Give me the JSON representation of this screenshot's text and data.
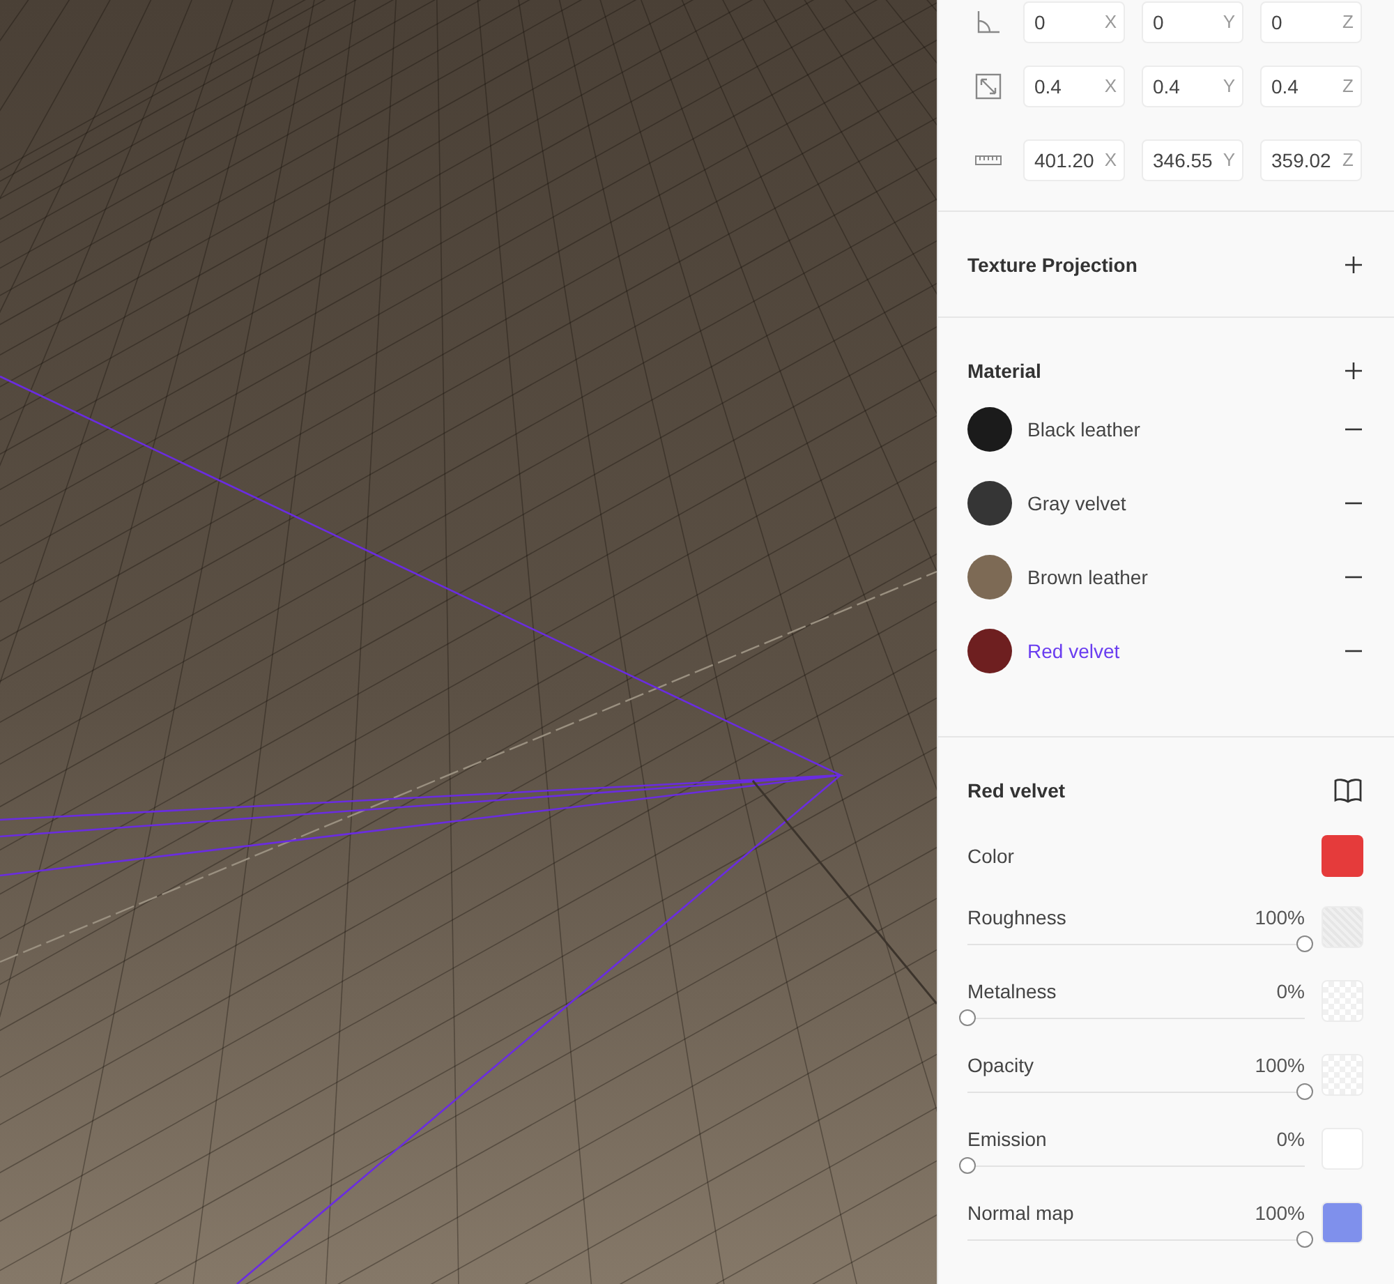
{
  "transform": [
    {
      "kind": "rotation",
      "fields": [
        {
          "value": "0",
          "axis": "X"
        },
        {
          "value": "0",
          "axis": "Y"
        },
        {
          "value": "0",
          "axis": "Z"
        }
      ]
    },
    {
      "kind": "scale",
      "fields": [
        {
          "value": "0.4",
          "axis": "X"
        },
        {
          "value": "0.4",
          "axis": "Y"
        },
        {
          "value": "0.4",
          "axis": "Z"
        }
      ]
    },
    {
      "kind": "dimensions",
      "fields": [
        {
          "value": "401.20",
          "axis": "X"
        },
        {
          "value": "346.55",
          "axis": "Y"
        },
        {
          "value": "359.02",
          "axis": "Z"
        }
      ]
    }
  ],
  "texture_projection": {
    "title": "Texture Projection"
  },
  "material": {
    "title": "Material",
    "items": [
      {
        "name": "Black leather",
        "color": "#1b1b1b",
        "selected": false
      },
      {
        "name": "Gray velvet",
        "color": "#353535",
        "selected": false
      },
      {
        "name": "Brown leather",
        "color": "#7d6a55",
        "selected": false
      },
      {
        "name": "Red velvet",
        "color": "#6e1f20",
        "selected": true
      }
    ]
  },
  "selected_material": {
    "title": "Red velvet",
    "color_label": "Color",
    "color": "#e53b3b",
    "properties": [
      {
        "label": "Roughness",
        "reading": "100%",
        "level": 1,
        "kind": "noise"
      },
      {
        "label": "Metalness",
        "reading": "0%",
        "level": 0,
        "kind": "checker"
      },
      {
        "label": "Opacity",
        "reading": "100%",
        "level": 1,
        "kind": "checker"
      },
      {
        "label": "Emission",
        "reading": "0%",
        "level": 0,
        "kind": "solid",
        "color": "#ffffff"
      },
      {
        "label": "Normal map",
        "reading": "100%",
        "level": 1,
        "kind": "solid",
        "color": "#7f90ec"
      }
    ]
  }
}
